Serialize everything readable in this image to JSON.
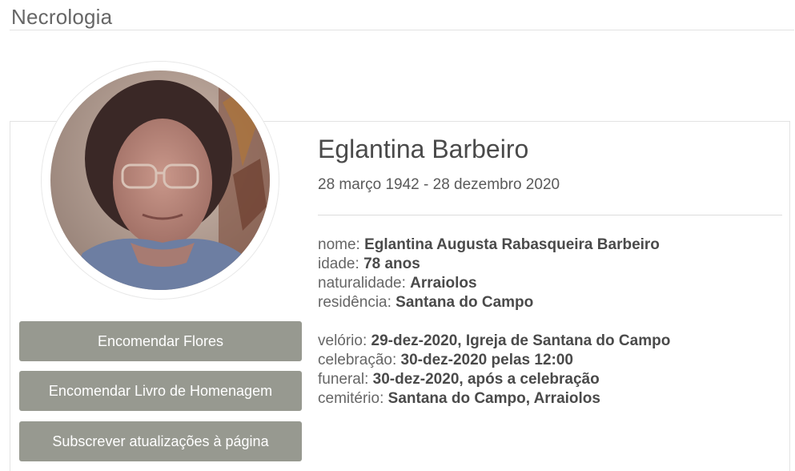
{
  "header": {
    "title": "Necrologia"
  },
  "profile": {
    "photo_alt": "portrait-photo",
    "name": "Eglantina Barbeiro",
    "dates": "28 março 1942 - 28 dezembro 2020"
  },
  "actions": {
    "order_flowers": "Encomendar Flores",
    "order_book": "Encomendar Livro de Homenagem",
    "subscribe": "Subscrever atualizações à página"
  },
  "details": {
    "personal": [
      {
        "label": "nome:",
        "value": "Eglantina Augusta Rabasqueira Barbeiro"
      },
      {
        "label": "idade:",
        "value": "78 anos"
      },
      {
        "label": "naturalidade:",
        "value": "Arraiolos"
      },
      {
        "label": "residência:",
        "value": "Santana do Campo"
      }
    ],
    "ceremony": [
      {
        "label": "velório:",
        "value": "29-dez-2020, Igreja de Santana do Campo"
      },
      {
        "label": "celebração:",
        "value": "30-dez-2020 pelas 12:00"
      },
      {
        "label": "funeral:",
        "value": "30-dez-2020, após a celebração"
      },
      {
        "label": "cemitério:",
        "value": "Santana do Campo, Arraiolos"
      }
    ]
  },
  "colors": {
    "button_bg": "#979990",
    "button_text": "#ffffff",
    "text_dark": "#4a4a4a",
    "text_muted": "#666666"
  }
}
